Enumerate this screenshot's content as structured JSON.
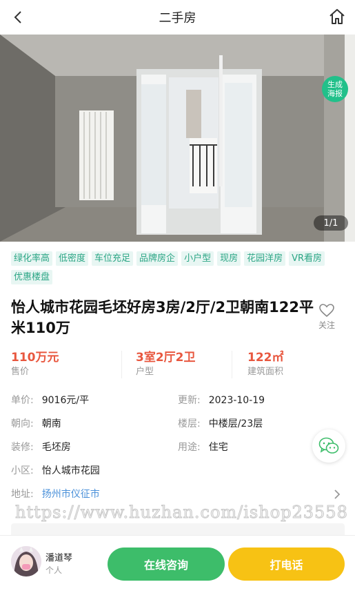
{
  "header": {
    "title": "二手房"
  },
  "hero": {
    "poster_badge": "生成海报",
    "photo_counter": "1/1"
  },
  "tags": [
    "绿化率高",
    "低密度",
    "车位充足",
    "品牌房企",
    "小户型",
    "现房",
    "花园洋房",
    "VR看房",
    "优惠楼盘"
  ],
  "listing": {
    "title": "怡人城市花园毛坯好房3房/2厅/2卫朝南122平米110万",
    "follow_label": "关注"
  },
  "kpis": [
    {
      "value": "110万元",
      "label": "售价"
    },
    {
      "value": "3室2厅2卫",
      "label": "户型"
    },
    {
      "value": "122㎡",
      "label": "建筑面积"
    }
  ],
  "attributes": {
    "unit_price": {
      "key": "单价:",
      "value": "9016元/平"
    },
    "updated": {
      "key": "更新:",
      "value": "2023-10-19"
    },
    "orientation": {
      "key": "朝向:",
      "value": "朝南"
    },
    "floor": {
      "key": "楼层:",
      "value": "中楼层/23层"
    },
    "decoration": {
      "key": "装修:",
      "value": "毛坯房"
    },
    "usage": {
      "key": "用途:",
      "value": "住宅"
    },
    "community": {
      "key": "小区:",
      "value": "怡人城市花园"
    },
    "address": {
      "key": "地址:",
      "value": "扬州市仪征市"
    }
  },
  "watermark": "https://www.huzhan.com/ishop23558",
  "agent": {
    "name": "潘道琴",
    "role": "个人"
  },
  "actions": {
    "consult_label": "在线咨询",
    "call_label": "打电话"
  },
  "colors": {
    "price_red": "#e8573f",
    "tag_green_text": "#2aa584",
    "tag_bg": "#e8f6f3",
    "consult_green": "#3dbd6a",
    "call_yellow": "#f7c214",
    "link_blue": "#4a90d9"
  },
  "icons": {
    "back": "chevron-left-icon",
    "home": "home-icon",
    "follow": "heart-outline-icon",
    "wechat": "wechat-icon",
    "address_chevron": "chevron-right-icon"
  }
}
